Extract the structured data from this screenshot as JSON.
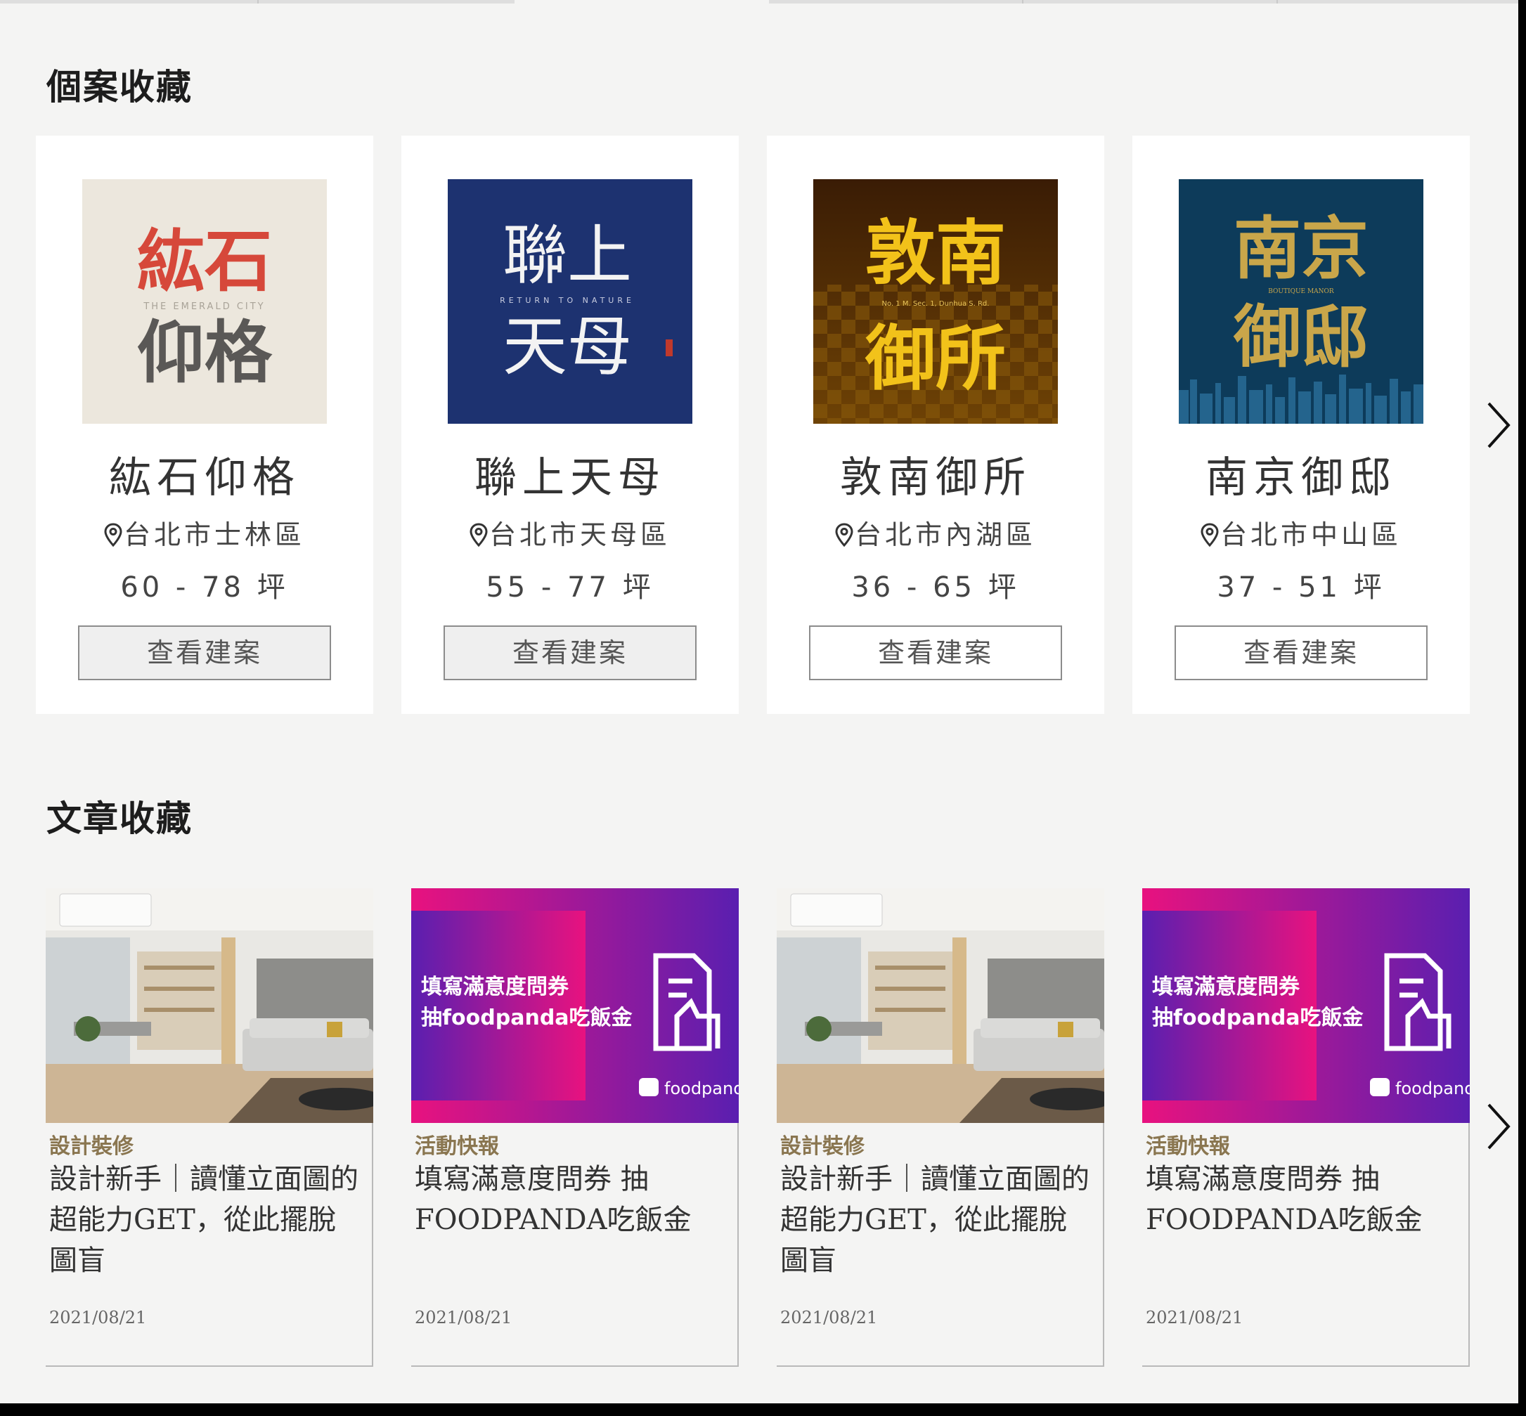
{
  "sections": {
    "projects_title": "個案收藏",
    "articles_title": "文章收藏"
  },
  "projects": [
    {
      "name": "紘石仰格",
      "logo_top": "紘石",
      "logo_bottom": "仰格",
      "logo_sub": "THE EMERALD CITY",
      "location": "台北市士林區",
      "size": "60 - 78 坪",
      "button": "查看建案",
      "button_style": "gray"
    },
    {
      "name": "聯上天母",
      "logo_top": "聯上",
      "logo_bottom": "天母",
      "logo_sub": "RETURN TO NATURE",
      "location": "台北市天母區",
      "size": "55 - 77 坪",
      "button": "查看建案",
      "button_style": "gray"
    },
    {
      "name": "敦南御所",
      "logo_top": "敦南",
      "logo_bottom": "御所",
      "logo_sub": "No. 1 M. Sec. 1, Dunhua S. Rd.",
      "location": "台北市內湖區",
      "size": "36 - 65 坪",
      "button": "查看建案",
      "button_style": "white"
    },
    {
      "name": "南京御邸",
      "logo_top": "南京",
      "logo_bottom": "御邸",
      "logo_sub": "BOUTIQUE MANOR",
      "location": "台北市中山區",
      "size": "37 - 51 坪",
      "button": "查看建案",
      "button_style": "white"
    }
  ],
  "articles": [
    {
      "category": "設計裝修",
      "title": "設計新手｜讀懂立面圖的超能力GET，從此擺脫圖盲",
      "date": "2021/08/21",
      "image": "living-room"
    },
    {
      "category": "活動快報",
      "title": "填寫滿意度問券 抽FOODPANDA吃飯金",
      "date": "2021/08/21",
      "image": "foodpanda-promo",
      "promo_line1": "填寫滿意度問券",
      "promo_line2": "抽foodpanda吃飯金",
      "promo_brand": "foodpand"
    },
    {
      "category": "設計裝修",
      "title": "設計新手｜讀懂立面圖的超能力GET，從此擺脫圖盲",
      "date": "2021/08/21",
      "image": "living-room"
    },
    {
      "category": "活動快報",
      "title": "填寫滿意度問券 抽FOODPANDA吃飯金",
      "date": "2021/08/21",
      "image": "foodpanda-promo",
      "promo_line1": "填寫滿意度問券",
      "promo_line2": "抽foodpanda吃飯金",
      "promo_brand": "foodpand"
    }
  ],
  "icons": {
    "location": "map-pin-icon",
    "next": "chevron-right-icon"
  },
  "colors": {
    "background": "#f4f4f3",
    "category": "#8a7650",
    "promo_magenta": "#e8127f",
    "promo_purple": "#5a1fb0"
  }
}
